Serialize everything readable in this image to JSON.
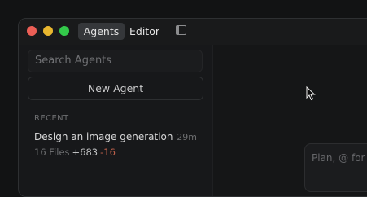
{
  "titlebar": {
    "tabs": [
      {
        "label": "Agents",
        "active": true
      },
      {
        "label": "Editor",
        "active": false
      }
    ],
    "sidebar_toggle_icon": "sidebar-toggle-icon"
  },
  "sidebar": {
    "search_placeholder": "Search Agents",
    "new_agent_label": "New Agent",
    "section_label": "RECENT",
    "agents": [
      {
        "title": "Design an image generation...",
        "time": "29m",
        "files": "16 Files",
        "additions": "+683",
        "deletions": "-16"
      }
    ]
  },
  "composer": {
    "placeholder": "Plan, @ for"
  },
  "colors": {
    "close": "#ec5f56",
    "minimize": "#e9b72f",
    "maximize": "#33c94a",
    "deletions": "#c0614b"
  }
}
